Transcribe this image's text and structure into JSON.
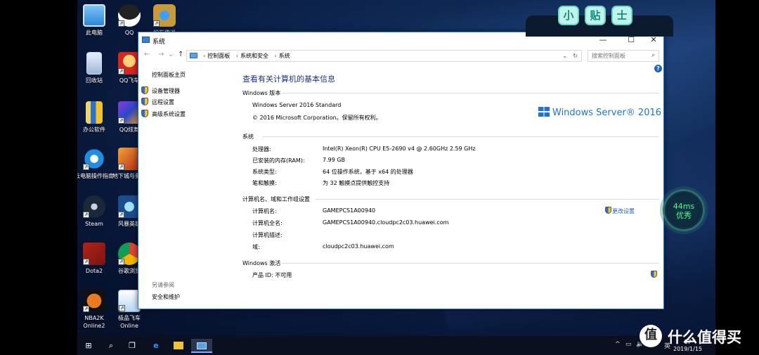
{
  "desktop_icons": [
    {
      "id": "pc",
      "label": "此电脑"
    },
    {
      "id": "qq",
      "label": "QQ"
    },
    {
      "id": "hearthstone",
      "label": "炉石传说"
    },
    {
      "id": "recycle",
      "label": "回收站"
    },
    {
      "id": "qqspeed",
      "label": "QQ飞车"
    },
    {
      "id": "office",
      "label": "办公软件"
    },
    {
      "id": "qqdance",
      "label": "QQ炫舞"
    },
    {
      "id": "ie",
      "label": "云电脑操作指南"
    },
    {
      "id": "lol",
      "label": "地下城与勇士"
    },
    {
      "id": "steam",
      "label": "Steam"
    },
    {
      "id": "fengbao",
      "label": "风暴英雄"
    },
    {
      "id": "dota2",
      "label": "Dota2"
    },
    {
      "id": "chrome",
      "label": "谷歌浏览"
    },
    {
      "id": "nba",
      "label": "NBA2K Online2"
    },
    {
      "id": "jipin",
      "label": "极品飞车 Online"
    }
  ],
  "tips": [
    "小",
    "贴",
    "士"
  ],
  "ping": {
    "value": "44ms",
    "quality": "优秀"
  },
  "window": {
    "title": "系统",
    "controls": {
      "min": "—",
      "max": "☐",
      "close": "✕"
    },
    "breadcrumbs": [
      "控制面板",
      "系统和安全",
      "系统"
    ],
    "search_placeholder": "搜索控制面板",
    "left_nav": {
      "home": "控制面板主页",
      "items": [
        "设备管理器",
        "远程设置",
        "高级系统设置"
      ],
      "see_also_title": "另请参阅",
      "see_also": "安全和维护"
    },
    "heading": "查看有关计算机的基本信息",
    "edition": {
      "section": "Windows 版本",
      "name": "Windows Server 2016 Standard",
      "copyright": "© 2016 Microsoft Corporation。保留所有权利。",
      "logo_text": "Windows Server® 2016"
    },
    "system": {
      "section": "系统",
      "rows": [
        {
          "label": "处理器:",
          "value": "Intel(R) Xeon(R) CPU E5-2690 v4 @ 2.60GHz   2.59 GHz"
        },
        {
          "label": "已安装的内存(RAM):",
          "value": "7.99 GB"
        },
        {
          "label": "系统类型:",
          "value": "64 位操作系统，基于 x64 的处理器"
        },
        {
          "label": "笔和触摸:",
          "value": "为 32 触摸点提供触控支持"
        }
      ]
    },
    "computer": {
      "section": "计算机名、域和工作组设置",
      "change_link": "更改设置",
      "rows": [
        {
          "label": "计算机名:",
          "value": "GAMEPCS1A00940"
        },
        {
          "label": "计算机全名:",
          "value": "GAMEPCS1A00940.cloudpc2c03.huawei.com"
        },
        {
          "label": "计算机描述:",
          "value": ""
        },
        {
          "label": "域:",
          "value": "cloudpc2c03.huawei.com"
        }
      ]
    },
    "activation": {
      "section": "Windows 激活",
      "product_id": "产品 ID: 不可用"
    }
  },
  "taskbar": {
    "ime": "英",
    "time": "17",
    "date": "2019/1/15"
  },
  "watermark": {
    "glyph": "值",
    "text": "什么值得买"
  }
}
